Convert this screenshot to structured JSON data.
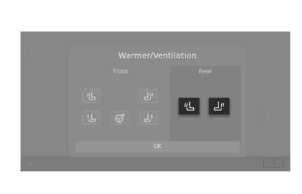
{
  "dialog": {
    "title": "Warmer/Ventilation",
    "front_label": "Front",
    "rear_label": "Rear",
    "ok_label": "OK"
  },
  "icons": {
    "front_driver_heat": "seat-heat-icon",
    "front_passenger_heat": "seat-heat-icon",
    "front_driver_vent": "seat-vent-icon",
    "steering_heat": "steering-wheel-heat-icon",
    "front_passenger_vent": "seat-vent-icon",
    "rear_left_heat": "seat-heat-icon",
    "rear_right_heat": "seat-heat-icon"
  },
  "state": {
    "rear_left_heat_active": true,
    "rear_right_heat_active": true
  },
  "colors": {
    "overlay": "#868686",
    "dialog": "#8b8b8b",
    "active_button": "#2b2b2b",
    "text": "#e9e9e9"
  }
}
